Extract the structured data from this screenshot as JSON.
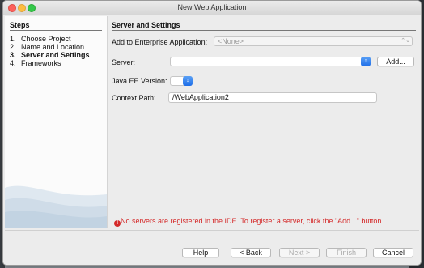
{
  "window": {
    "title": "New Web Application"
  },
  "steps": {
    "heading": "Steps",
    "items": [
      {
        "num": "1.",
        "label": "Choose Project"
      },
      {
        "num": "2.",
        "label": "Name and Location"
      },
      {
        "num": "3.",
        "label": "Server and Settings",
        "active": true
      },
      {
        "num": "4.",
        "label": "Frameworks"
      }
    ]
  },
  "main": {
    "section_title": "Server and Settings",
    "enterprise_label": "Add to Enterprise Application:",
    "enterprise_value": "<None>",
    "server_label": "Server:",
    "server_value": "",
    "add_button": "Add...",
    "javaee_label": "Java EE Version:",
    "javaee_value": "..",
    "context_label": "Context Path:",
    "context_value": "/WebApplication2",
    "error_message": "No servers are registered in the IDE. To register a server, click the \"Add...\" button."
  },
  "footer": {
    "help": "Help",
    "back": "< Back",
    "next": "Next >",
    "finish": "Finish",
    "cancel": "Cancel"
  },
  "colors": {
    "error": "#d42a2a",
    "accent": "#1e6ee8"
  },
  "icons": {
    "error": "error-icon",
    "combo": "chevron-updown-icon"
  }
}
